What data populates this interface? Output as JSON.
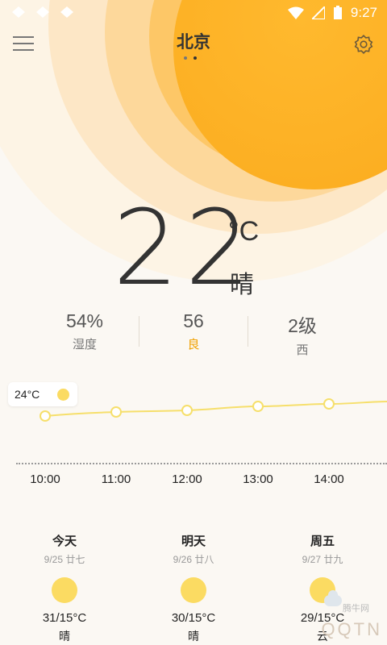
{
  "status_bar": {
    "time": "9:27"
  },
  "header": {
    "city": "北京",
    "page_dots": 2,
    "active_dot": 1
  },
  "current": {
    "temperature": "22",
    "unit": "°C",
    "condition": "晴"
  },
  "stats": [
    {
      "value": "54%",
      "label": "湿度"
    },
    {
      "value": "56",
      "label": "良"
    },
    {
      "value": "2级",
      "label": "西"
    }
  ],
  "hourly": {
    "now_label": "24°C",
    "hours": [
      "10:00",
      "11:00",
      "12:00",
      "13:00",
      "14:00"
    ]
  },
  "daily": [
    {
      "name": "今天",
      "date": "9/25 廿七",
      "range": "31/15°C",
      "condition": "晴",
      "icon": "sun-icon"
    },
    {
      "name": "明天",
      "date": "9/26 廿八",
      "range": "30/15°C",
      "condition": "晴",
      "icon": "sun-icon"
    },
    {
      "name": "周五",
      "date": "9/27 廿九",
      "range": "29/15°C",
      "condition": "云",
      "icon": "partly-cloudy-icon"
    }
  ],
  "watermark": {
    "text": "QQTN",
    "small": "腾牛网"
  },
  "colors": {
    "sun": "#fbab1e",
    "accent": "#f0a000",
    "icon_sun": "#fbdb62"
  }
}
